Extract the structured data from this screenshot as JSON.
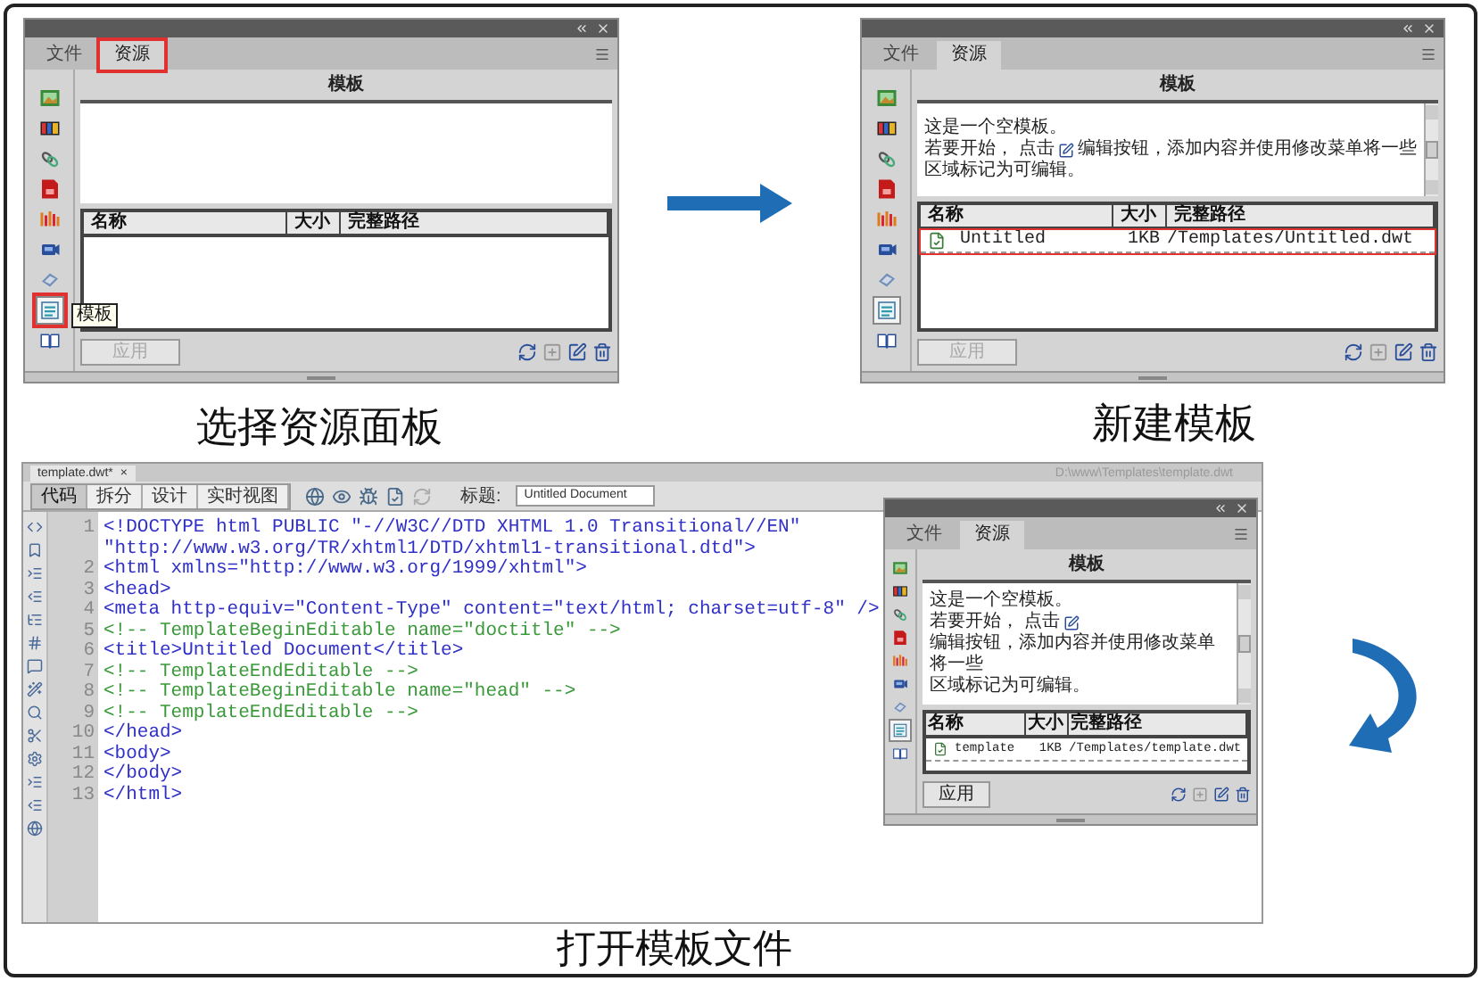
{
  "panels": [
    {
      "tabs": [
        {
          "label": "文件",
          "selected": false,
          "annotated": false
        },
        {
          "label": "资源",
          "selected": true,
          "annotated": true
        }
      ],
      "assets": [
        {
          "kind": "image",
          "selected": false,
          "annotated": false
        },
        {
          "kind": "color",
          "selected": false,
          "annotated": false
        },
        {
          "kind": "link",
          "selected": false,
          "annotated": false
        },
        {
          "kind": "flash",
          "selected": false,
          "annotated": false
        },
        {
          "kind": "media",
          "selected": false,
          "annotated": false
        },
        {
          "kind": "movie",
          "selected": false,
          "annotated": false
        },
        {
          "kind": "script",
          "selected": false,
          "annotated": false
        },
        {
          "kind": "template",
          "selected": true,
          "annotated": true
        },
        {
          "kind": "library",
          "selected": false,
          "annotated": false
        }
      ],
      "title": "模板",
      "columns": [
        "名称",
        "大小",
        "完整路径"
      ],
      "apply_button": {
        "label": "应用",
        "disabled": true
      },
      "tooltip": "模板"
    },
    {
      "tabs": [
        {
          "label": "文件",
          "selected": false,
          "annotated": false
        },
        {
          "label": "资源",
          "selected": true,
          "annotated": false
        }
      ],
      "assets": [
        {
          "kind": "image",
          "selected": false,
          "annotated": false
        },
        {
          "kind": "color",
          "selected": false,
          "annotated": false
        },
        {
          "kind": "link",
          "selected": false,
          "annotated": false
        },
        {
          "kind": "flash",
          "selected": false,
          "annotated": false
        },
        {
          "kind": "media",
          "selected": false,
          "annotated": false
        },
        {
          "kind": "movie",
          "selected": false,
          "annotated": false
        },
        {
          "kind": "script",
          "selected": false,
          "annotated": false
        },
        {
          "kind": "template",
          "selected": true,
          "annotated": false
        },
        {
          "kind": "library",
          "selected": false,
          "annotated": false
        }
      ],
      "title": "模板",
      "description": {
        "intro": "这是一个空模板。",
        "before_icon": "若要开始， 点击",
        "after_icon": "编辑按钮，添加内容并使用修改菜单将一些",
        "last_line": "区域标记为可编辑。"
      },
      "columns": [
        "名称",
        "大小",
        "完整路径"
      ],
      "rows": [
        {
          "name": "Untitled",
          "size": "1KB",
          "path": "/Templates/Untitled.dwt",
          "annotated": true
        }
      ],
      "apply_button": {
        "label": "应用",
        "disabled": true
      }
    },
    {
      "tabs": [
        {
          "label": "文件",
          "selected": false,
          "annotated": false
        },
        {
          "label": "资源",
          "selected": true,
          "annotated": false
        }
      ],
      "assets": [
        {
          "kind": "image",
          "selected": false,
          "annotated": false
        },
        {
          "kind": "color",
          "selected": false,
          "annotated": false
        },
        {
          "kind": "link",
          "selected": false,
          "annotated": false
        },
        {
          "kind": "flash",
          "selected": false,
          "annotated": false
        },
        {
          "kind": "media",
          "selected": false,
          "annotated": false
        },
        {
          "kind": "movie",
          "selected": false,
          "annotated": false
        },
        {
          "kind": "script",
          "selected": false,
          "annotated": false
        },
        {
          "kind": "template",
          "selected": true,
          "annotated": false
        },
        {
          "kind": "library",
          "selected": false,
          "annotated": false
        }
      ],
      "title": "模板",
      "description": {
        "intro": "这是一个空模板。",
        "before_icon": "若要开始， 点击",
        "after_icon": "编辑按钮，添加内容并使用修改菜单将一些",
        "last_line": "区域标记为可编辑。"
      },
      "columns": [
        "名称",
        "大小",
        "完整路径"
      ],
      "rows": [
        {
          "name": "template",
          "size": "1KB",
          "path": "/Templates/template.dwt",
          "annotated": false
        }
      ],
      "apply_button": {
        "label": "应用",
        "disabled": false
      }
    }
  ],
  "captions": [
    "选择资源面板",
    "新建模板",
    "打开模板文件"
  ],
  "editor": {
    "file_tab": "template.dwt*",
    "close": "×",
    "path": "D:\\www\\Templates\\template.dwt",
    "view_buttons": [
      {
        "label": "代码",
        "selected": true
      },
      {
        "label": "拆分",
        "selected": false
      },
      {
        "label": "设计",
        "selected": false
      },
      {
        "label": "实时视图",
        "selected": false
      }
    ],
    "title_label": "标题:",
    "title_value": "Untitled Document",
    "lines": [
      {
        "number": "1",
        "text": "<!DOCTYPE html PUBLIC \"-//W3C//DTD XHTML 1.0 Transitional//EN\"",
        "continuation": "\"http://www.w3.org/TR/xhtml1/DTD/xhtml1-transitional.dtd\">",
        "kind": "tag"
      },
      {
        "number": "2",
        "text": "<html xmlns=\"http://www.w3.org/1999/xhtml\">",
        "kind": "tag"
      },
      {
        "number": "3",
        "text": "<head>",
        "kind": "tag"
      },
      {
        "number": "4",
        "text": "<meta http-equiv=\"Content-Type\" content=\"text/html; charset=utf-8\" />",
        "kind": "tag"
      },
      {
        "number": "5",
        "text": "<!-- TemplateBeginEditable name=\"doctitle\" -->",
        "kind": "comment"
      },
      {
        "number": "6",
        "text": "<title>Untitled Document</title>",
        "kind": "tag"
      },
      {
        "number": "7",
        "text": "<!-- TemplateEndEditable -->",
        "kind": "comment"
      },
      {
        "number": "8",
        "text": "<!-- TemplateBeginEditable name=\"head\" -->",
        "kind": "comment"
      },
      {
        "number": "9",
        "text": "<!-- TemplateEndEditable -->",
        "kind": "comment"
      },
      {
        "number": "10",
        "text": "</head>",
        "kind": "tag"
      },
      {
        "number": "11",
        "text": "<body>",
        "kind": "tag"
      },
      {
        "number": "12",
        "text": "</body>",
        "kind": "tag"
      },
      {
        "number": "13",
        "text": "</html>",
        "kind": "tag"
      }
    ]
  }
}
